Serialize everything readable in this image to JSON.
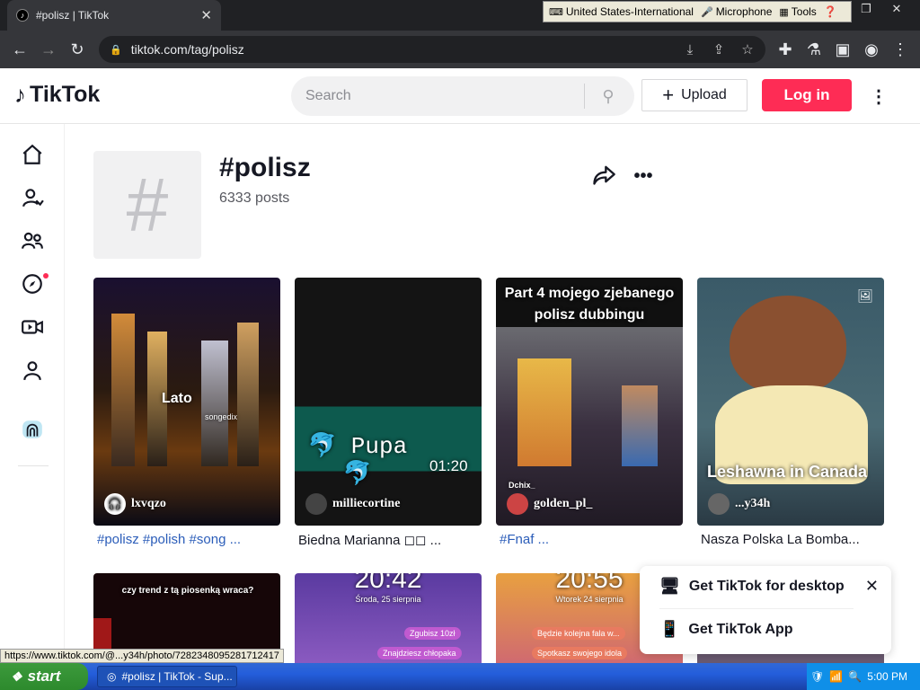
{
  "browser": {
    "tab_title": "#polisz | TikTok",
    "tab_close": "✕",
    "url": "tiktok.com/tag/polisz",
    "lang_bar": {
      "language": "United States-International",
      "microphone": "Microphone",
      "tools": "Tools"
    }
  },
  "header": {
    "logo_text": "TikTok",
    "search_placeholder": "Search",
    "upload_label": "Upload",
    "login_label": "Log in"
  },
  "tag": {
    "title": "#polisz",
    "posts": "6333 posts"
  },
  "videos": [
    {
      "user": "lxvqzo",
      "caption": "#polisz #polish #song ...",
      "overlay": "Lato",
      "overlay2": "songedix"
    },
    {
      "user": "milliecortine",
      "caption": "Biedna Marianna ◻◻ ...",
      "overlay": "🐬 Pupa 🐬",
      "overlay2": "01:20"
    },
    {
      "user": "golden_pl_",
      "caption": "#Fnaf ...",
      "overlay": "Part 4 mojego zjebanego polisz dubbingu",
      "overlay2": "Dchix_"
    },
    {
      "user": "...y34h",
      "caption": "Nasza Polska La Bomba...",
      "overlay": "Leshawna in Canada"
    }
  ],
  "videos_row2": [
    {
      "overlay": "czy trend z tą piosenką wraca?"
    },
    {
      "overlay": "20:42",
      "sub": "Środa, 25 sierpnia",
      "n1": "Zgubisz 10zł",
      "n2": "Znajdziesz chłopaka"
    },
    {
      "overlay": "20:55",
      "sub": "Wtorek 24 sierpnia",
      "n1": "Będzie kolejna fala w...",
      "n2": "Spotkasz swojego idola"
    }
  ],
  "popup": {
    "desktop_label": "Get TikTok for desktop",
    "app_label": "Get TikTok App"
  },
  "status_url": "https://www.tiktok.com/@...y34h/photo/7282348095281712417",
  "taskbar": {
    "start": "start",
    "task_title": "#polisz | TikTok - Sup...",
    "clock": "5:00 PM"
  },
  "colors": {
    "brand": "#fe2c55",
    "hashtag": "#2b5db9"
  }
}
